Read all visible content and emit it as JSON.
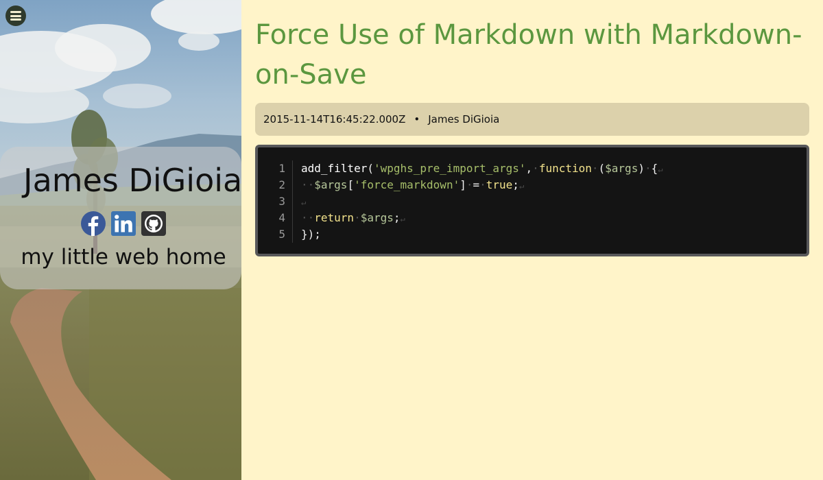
{
  "sidebar": {
    "name": "James DiGioia",
    "tagline": "my little web home",
    "menu_icon": "hamburger-menu-icon",
    "social": [
      {
        "name": "Facebook",
        "icon": "facebook-icon",
        "color": "#3b5998"
      },
      {
        "name": "LinkedIn",
        "icon": "linkedin-icon",
        "color": "#3d74b1"
      },
      {
        "name": "GitHub",
        "icon": "github-icon",
        "color": "#24292e"
      }
    ]
  },
  "post": {
    "title": "Force Use of Markdown with Markdown-on-Save",
    "date": "2015-11-14T16:45:22.000Z",
    "separator": "•",
    "author": "James DiGioia"
  },
  "code": {
    "lines": [
      {
        "n": "1",
        "tokens": [
          {
            "t": "fn",
            "v": "add_filter"
          },
          {
            "t": "pl",
            "v": "("
          },
          {
            "t": "str",
            "v": "'wpghs_pre_import_args'"
          },
          {
            "t": "pl",
            "v": ","
          },
          {
            "t": "ws",
            "v": "·"
          },
          {
            "t": "kw",
            "v": "function"
          },
          {
            "t": "ws",
            "v": "·"
          },
          {
            "t": "pl",
            "v": "("
          },
          {
            "t": "var",
            "v": "$args"
          },
          {
            "t": "pl",
            "v": ")"
          },
          {
            "t": "ws",
            "v": "·"
          },
          {
            "t": "pl",
            "v": "{"
          },
          {
            "t": "nl",
            "v": "↵"
          }
        ]
      },
      {
        "n": "2",
        "tokens": [
          {
            "t": "ws",
            "v": "··"
          },
          {
            "t": "var",
            "v": "$args"
          },
          {
            "t": "pl",
            "v": "["
          },
          {
            "t": "str",
            "v": "'force_markdown'"
          },
          {
            "t": "pl",
            "v": "]"
          },
          {
            "t": "ws",
            "v": "·"
          },
          {
            "t": "pl",
            "v": "="
          },
          {
            "t": "ws",
            "v": "·"
          },
          {
            "t": "kw",
            "v": "true"
          },
          {
            "t": "pl",
            "v": ";"
          },
          {
            "t": "nl",
            "v": "↵"
          }
        ]
      },
      {
        "n": "3",
        "tokens": [
          {
            "t": "nl",
            "v": "↵"
          }
        ]
      },
      {
        "n": "4",
        "tokens": [
          {
            "t": "ws",
            "v": "··"
          },
          {
            "t": "kw",
            "v": "return"
          },
          {
            "t": "ws",
            "v": "·"
          },
          {
            "t": "var",
            "v": "$args"
          },
          {
            "t": "pl",
            "v": ";"
          },
          {
            "t": "nl",
            "v": "↵"
          }
        ]
      },
      {
        "n": "5",
        "tokens": [
          {
            "t": "pl",
            "v": "});"
          }
        ]
      }
    ]
  }
}
